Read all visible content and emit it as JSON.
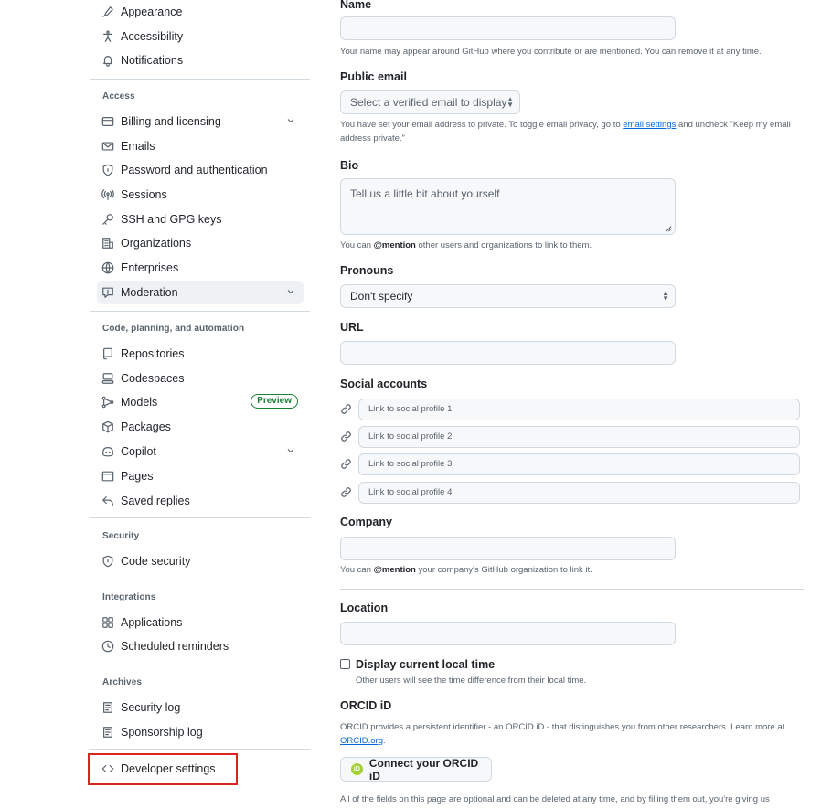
{
  "sidebar": {
    "top_items": [
      {
        "label": "Appearance",
        "icon": "paintbrush-icon"
      },
      {
        "label": "Accessibility",
        "icon": "accessibility-icon"
      },
      {
        "label": "Notifications",
        "icon": "bell-icon"
      }
    ],
    "sections": {
      "access": "Access",
      "code": "Code, planning, and automation",
      "security": "Security",
      "integrations": "Integrations",
      "archives": "Archives"
    },
    "access_items": [
      {
        "label": "Billing and licensing",
        "icon": "credit-card-icon",
        "expandable": true
      },
      {
        "label": "Emails",
        "icon": "mail-icon"
      },
      {
        "label": "Password and authentication",
        "icon": "shield-lock-icon"
      },
      {
        "label": "Sessions",
        "icon": "broadcast-icon"
      },
      {
        "label": "SSH and GPG keys",
        "icon": "key-icon"
      },
      {
        "label": "Organizations",
        "icon": "organization-icon"
      },
      {
        "label": "Enterprises",
        "icon": "globe-icon"
      },
      {
        "label": "Moderation",
        "icon": "report-icon",
        "expandable": true,
        "active": true
      }
    ],
    "code_items": [
      {
        "label": "Repositories",
        "icon": "repo-icon"
      },
      {
        "label": "Codespaces",
        "icon": "codespaces-icon"
      },
      {
        "label": "Models",
        "icon": "ai-model-icon",
        "badge": "Preview"
      },
      {
        "label": "Packages",
        "icon": "package-icon"
      },
      {
        "label": "Copilot",
        "icon": "copilot-icon",
        "expandable": true
      },
      {
        "label": "Pages",
        "icon": "browser-icon"
      },
      {
        "label": "Saved replies",
        "icon": "reply-icon"
      }
    ],
    "security_items": [
      {
        "label": "Code security",
        "icon": "shield-icon"
      }
    ],
    "integrations_items": [
      {
        "label": "Applications",
        "icon": "apps-icon"
      },
      {
        "label": "Scheduled reminders",
        "icon": "clock-icon"
      }
    ],
    "archives_items": [
      {
        "label": "Security log",
        "icon": "log-icon"
      },
      {
        "label": "Sponsorship log",
        "icon": "log-icon"
      }
    ],
    "developer_settings": "Developer settings",
    "accent_red": "#d9251f"
  },
  "form": {
    "name_label": "Name",
    "name_note": "Your name may appear around GitHub where you contribute or are mentioned. You can remove it at any time.",
    "email_label": "Public email",
    "email_select": "Select a verified email to display",
    "email_note_1": "You have set your email address to private. To toggle email privacy, go to",
    "email_note_link": "email settings",
    "email_note_2": "and uncheck \"Keep my email address private.\"",
    "bio_label": "Bio",
    "bio_placeholder": "Tell us a little bit about yourself",
    "bio_note_1": "You can",
    "bio_note_mention": "@mention",
    "bio_note_2": "other users and organizations to link to them.",
    "pronouns_label": "Pronouns",
    "pronouns_value": "Don't specify",
    "url_label": "URL",
    "social_label": "Social accounts",
    "social_placeholders": [
      "Link to social profile 1",
      "Link to social profile 2",
      "Link to social profile 3",
      "Link to social profile 4"
    ],
    "company_label": "Company",
    "company_note_1": "You can",
    "company_note_mention": "@mention",
    "company_note_2": "your company's GitHub organization to link it.",
    "location_label": "Location",
    "time_checkbox_label": "Display current local time",
    "time_note": "Other users will see the time difference from their local time.",
    "orcid_label": "ORCID iD",
    "orcid_note_1": "ORCID provides a persistent identifier - an ORCID iD - that distinguishes you from other researchers. Learn more at",
    "orcid_note_link": "ORCID.org",
    "orcid_note_2": ".",
    "orcid_button": "Connect your ORCID iD",
    "orcid_logo_text": "iD",
    "footer_note": "All of the fields on this page are optional and can be deleted at any time, and by filling them out, you're giving us"
  }
}
